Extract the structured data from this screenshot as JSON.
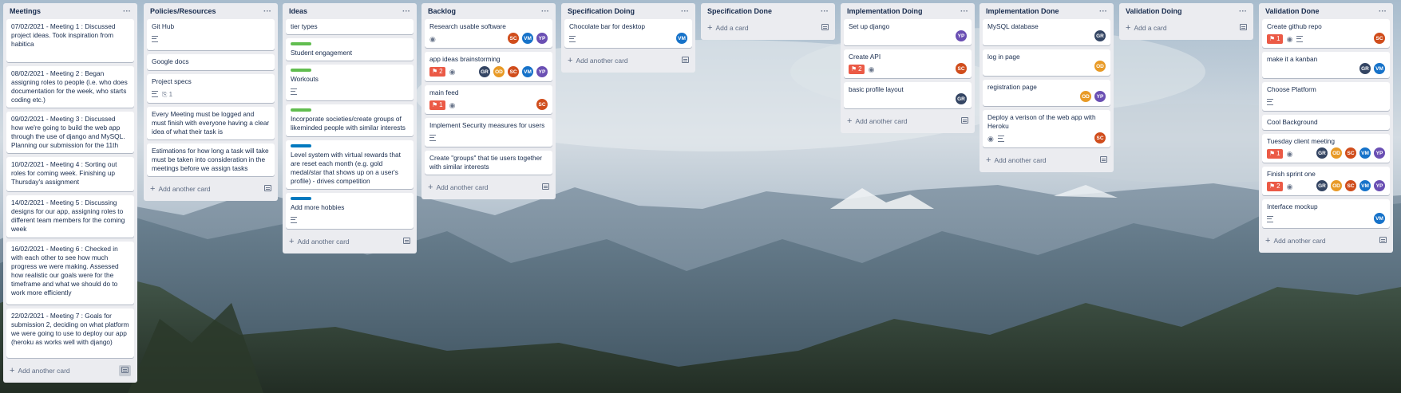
{
  "colors": {
    "label_green": "#61bd4f",
    "label_blue": "#0079bf",
    "notification_red": "#eb5a46",
    "list_bg": "#ebecf0"
  },
  "avatars": {
    "SC": "#d04d1c",
    "VM": "#1672c9",
    "YP": "#6a4fb3",
    "GR": "#344563",
    "OD": "#e89a26"
  },
  "icons": {
    "more": "more-icon",
    "description": "description-icon",
    "watch": "eye-icon",
    "attachment": "paperclip-icon",
    "notification": "bell-icon",
    "template": "card-template-icon",
    "add": "plus-icon"
  },
  "lists": [
    {
      "title": "Meetings",
      "add_label": "Add another card",
      "cards": [
        {
          "title": "07/02/2021 - Meeting 1 : Discussed project ideas. Took inspiration from habitica"
        },
        {
          "title": "08/02/2021 - Meeting 2 : Began assigning roles to people (i.e. who does documentation for the week, who starts coding etc.)"
        },
        {
          "title": "09/02/2021 - Meeting 3 : Discussed how we're going to build the web app through the use of django and MySQL. Planning our submission for the 11th"
        },
        {
          "title": "10/02/2021 - Meeting 4 : Sorting out roles for coming week. Finishing up Thursday's assignment"
        },
        {
          "title": "14/02/2021 - Meeting 5 : Discussing designs for our app, assigning roles to different team members for the coming week"
        },
        {
          "title": "16/02/2021 - Meeting 6 : Checked in with each other to see how much progress we were making. Assessed how realistic our goals were for the timeframe and what we should do to work more efficiently"
        },
        {
          "title": "22/02/2021 - Meeting 7 : Goals for submission 2, deciding on what platform we were going to use to deploy our app (heroku as works well with django)"
        }
      ]
    },
    {
      "title": "Policies/Resources",
      "add_label": "Add another card",
      "cards": [
        {
          "title": "Git Hub",
          "desc": true
        },
        {
          "title": "Google docs"
        },
        {
          "title": "Project specs",
          "desc": true,
          "attach": "1"
        },
        {
          "title": "Every Meeting must be logged and must finish with everyone having a clear idea of what their task is"
        },
        {
          "title": "Estimations for how long a task will take must be taken into consideration in the meetings before we assign tasks"
        }
      ]
    },
    {
      "title": "Ideas",
      "add_label": "Add another card",
      "cards": [
        {
          "title": "tier types"
        },
        {
          "title": "Student engagement",
          "label": "green"
        },
        {
          "title": "Workouts",
          "label": "green",
          "desc": true
        },
        {
          "title": "Incorporate societies/create groups of likeminded people with similar interests",
          "label": "green"
        },
        {
          "title": "Level system with virtual rewards that are reset each month (e.g. gold medal/star that shows up on a user's profile) - drives competition",
          "label": "blue"
        },
        {
          "title": "Add more hobbies",
          "label": "blue",
          "desc": true
        }
      ]
    },
    {
      "title": "Backlog",
      "add_label": "Add another card",
      "cards": [
        {
          "title": "Research usable software",
          "watch": true,
          "members": [
            "SC",
            "VM",
            "YP"
          ]
        },
        {
          "title": "app ideas brainstorming",
          "notif": "2",
          "watch": true,
          "members": [
            "GR",
            "OD",
            "SC",
            "VM",
            "YP"
          ]
        },
        {
          "title": "main feed",
          "notif": "1",
          "watch": true,
          "members": [
            "SC"
          ]
        },
        {
          "title": "Implement Security measures for users",
          "desc": true
        },
        {
          "title": "Create \"groups\" that tie users together with similar interests"
        }
      ]
    },
    {
      "title": "Specification Doing",
      "add_label": "Add another card",
      "cards": [
        {
          "title": "Chocolate bar for desktop",
          "desc": true,
          "members": [
            "VM"
          ]
        }
      ]
    },
    {
      "title": "Specification Done",
      "add_label": "Add a card",
      "cards": []
    },
    {
      "title": "Implementation Doing",
      "add_label": "Add another card",
      "cards": [
        {
          "title": "Set up django",
          "members": [
            "YP"
          ]
        },
        {
          "title": "Create API",
          "notif": "2",
          "watch": true,
          "members": [
            "SC"
          ]
        },
        {
          "title": "basic profile layout",
          "members": [
            "GR"
          ]
        }
      ]
    },
    {
      "title": "Implementation Done",
      "add_label": "Add another card",
      "cards": [
        {
          "title": "MySQL database",
          "members": [
            "GR"
          ]
        },
        {
          "title": "log in page",
          "members": [
            "OD"
          ]
        },
        {
          "title": "registration page",
          "members": [
            "OD",
            "YP"
          ]
        },
        {
          "title": "Deploy a verison of the web app with Heroku",
          "watch": true,
          "desc": true,
          "members": [
            "SC"
          ]
        }
      ]
    },
    {
      "title": "Validation Doing",
      "add_label": "Add a card",
      "cards": []
    },
    {
      "title": "Validation Done",
      "add_label": "Add another card",
      "cards": [
        {
          "title": "Create github repo",
          "notif": "1",
          "watch": true,
          "desc": true,
          "members": [
            "SC"
          ]
        },
        {
          "title": "make it a kanban",
          "members": [
            "GR",
            "VM"
          ]
        },
        {
          "title": "Choose Platform",
          "desc": true
        },
        {
          "title": "Cool Background"
        },
        {
          "title": "Tuesday client meeting",
          "notif": "1",
          "watch": true,
          "members": [
            "GR",
            "OD",
            "SC",
            "VM",
            "YP"
          ]
        },
        {
          "title": "Finish sprint one",
          "notif": "2",
          "watch": true,
          "members": [
            "GR",
            "OD",
            "SC",
            "VM",
            "YP"
          ]
        },
        {
          "title": "Interface mockup",
          "desc": true,
          "members": [
            "VM"
          ]
        }
      ]
    }
  ]
}
